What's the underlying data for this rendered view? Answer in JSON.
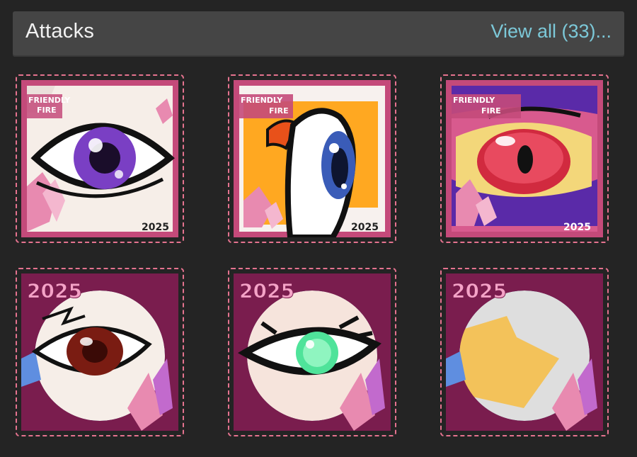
{
  "section": {
    "title": "Attacks",
    "view_all_label": "View all (33)..."
  },
  "cards": [
    {
      "banner_line1": "FRIENDLY",
      "banner_line2": "FIRE",
      "year": "2025",
      "eye_color": "#7a3fc4"
    },
    {
      "banner_line1": "FRIENDLY",
      "banner_line2": "FIRE",
      "year": "2025",
      "eye_color": "#3a5cb8"
    },
    {
      "banner_line1": "FRIENDLY",
      "banner_line2": "FIRE",
      "year": "2025",
      "eye_color": "#d12a3f"
    },
    {
      "year": "2025",
      "eye_color": "#7a1c12"
    },
    {
      "year": "2025",
      "eye_color": "#4fe39a"
    },
    {
      "year": "2025",
      "eye_color": "#f3c25a"
    }
  ],
  "colors": {
    "background": "#242424",
    "header_bg": "#454545",
    "link": "#7cc8d8",
    "card_border": "#e5738f",
    "frame_pink": "#c44a7a",
    "frame_magenta": "#7a1d4e"
  }
}
